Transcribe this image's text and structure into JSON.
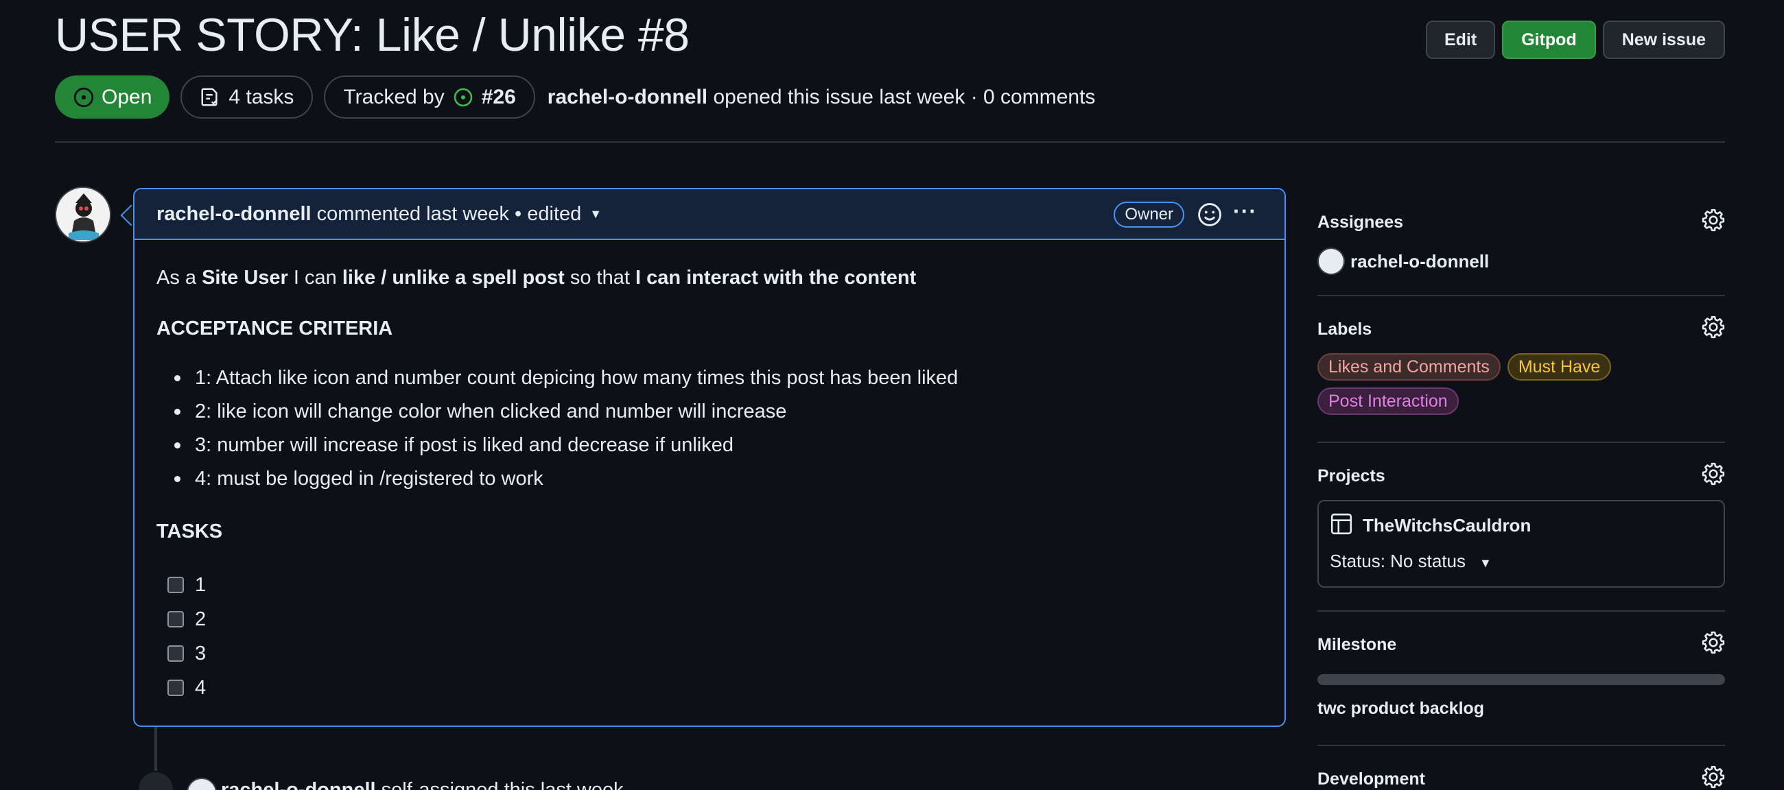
{
  "issue": {
    "title": "USER STORY: Like / Unlike #8",
    "state": "Open",
    "tasks_label": "4 tasks",
    "tracked_label": "Tracked by",
    "tracked_issue": "#26",
    "author": "rachel-o-donnell",
    "opened_text": "opened this issue last week · 0 comments"
  },
  "header_buttons": {
    "edit": "Edit",
    "gitpod": "Gitpod",
    "new_issue": "New issue"
  },
  "comment": {
    "author": "rachel-o-donnell",
    "action": "commented last week",
    "edited": "• edited",
    "role_badge": "Owner",
    "intro": {
      "p1": "As a ",
      "b1": "Site User",
      "p2": " I can ",
      "b2": "like / unlike a spell post",
      "p3": " so that ",
      "b3": "I can interact with the content"
    },
    "acceptance_heading": "ACCEPTANCE CRITERIA",
    "criteria": [
      "1: Attach like icon and number count depicing how many times this post has been liked",
      "2: like icon will change color when clicked and number will increase",
      "3: number will increase if post is liked and decrease if unliked",
      "4: must be logged in /registered to work"
    ],
    "tasks_heading": "TASKS",
    "tasks": [
      "1",
      "2",
      "3",
      "4"
    ]
  },
  "timeline": {
    "author": "rachel-o-donnell",
    "text": " self-assigned this last week"
  },
  "sidebar": {
    "assignees": {
      "title": "Assignees",
      "user": "rachel-o-donnell"
    },
    "labels": {
      "title": "Labels",
      "items": [
        {
          "name": "Likes and Comments",
          "color": "#f0a6a0",
          "bg": "#3d2a2a",
          "border": "#6e3f3b"
        },
        {
          "name": "Must Have",
          "color": "#f5c445",
          "bg": "#3b3213",
          "border": "#7a6420"
        },
        {
          "name": "Post Interaction",
          "color": "#e27fe7",
          "bg": "#3b1f3d",
          "border": "#6f3773"
        }
      ]
    },
    "projects": {
      "title": "Projects",
      "name": "TheWitchsCauldron",
      "status": "Status: No status"
    },
    "milestone": {
      "title": "Milestone",
      "name": "twc product backlog",
      "progress": 0
    },
    "development": {
      "title": "Development"
    }
  },
  "colors": {
    "accent_blue": "#4493f8",
    "green": "#238636",
    "background": "#0d1117"
  }
}
